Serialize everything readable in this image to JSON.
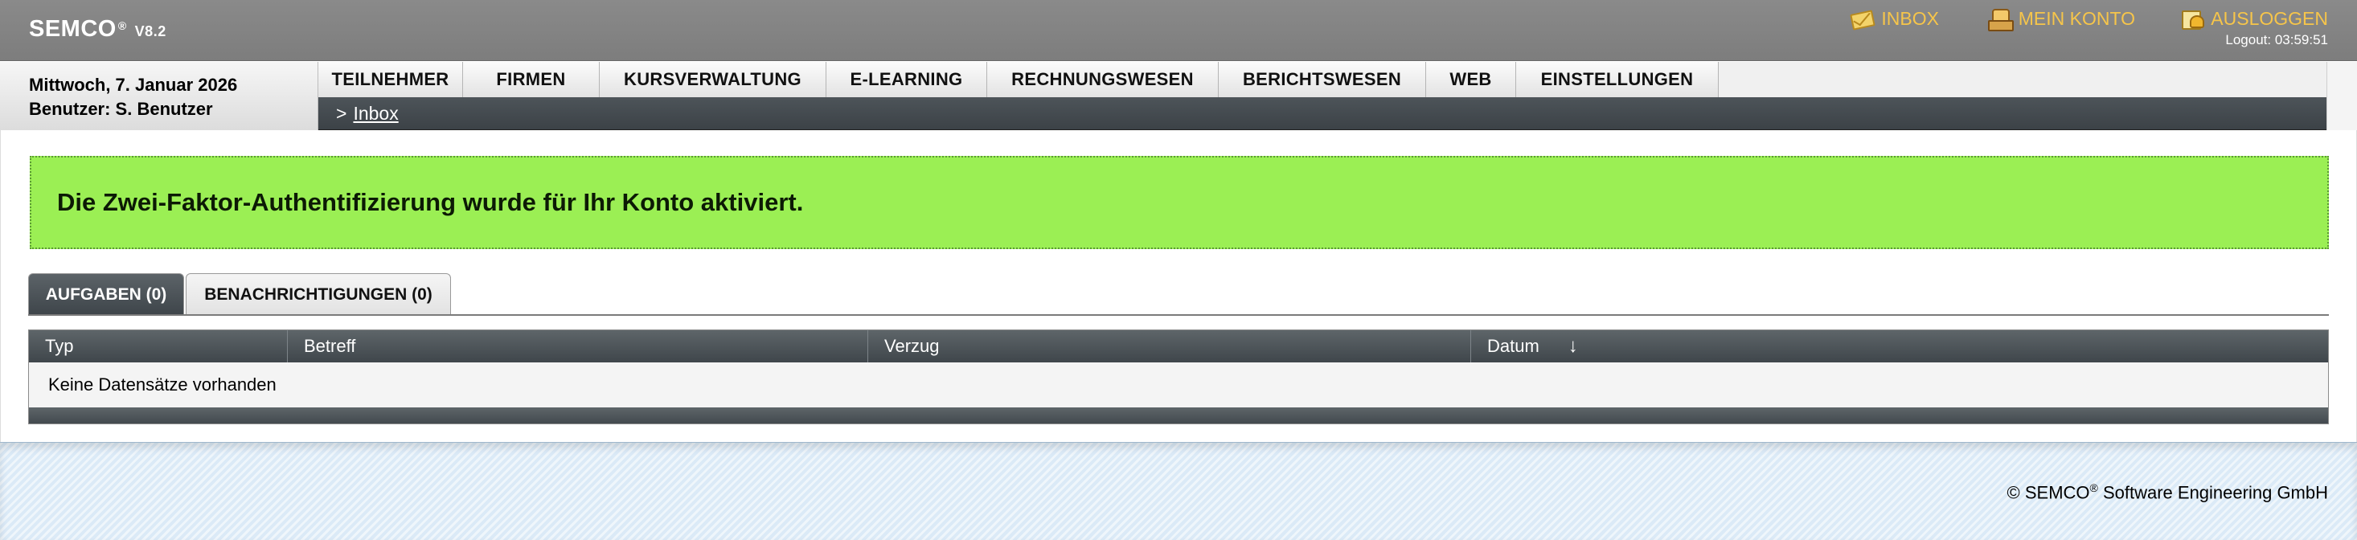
{
  "header": {
    "brand": "SEMCO",
    "brand_reg": "®",
    "version": "V8.2",
    "links": {
      "inbox": "INBOX",
      "account": "MEIN KONTO",
      "logout": "AUSLOGGEN"
    },
    "logout_timer": "Logout: 03:59:51",
    "link_color": "#f6c54a"
  },
  "info": {
    "date": "Mittwoch, 7. Januar 2026",
    "user": "Benutzer: S. Benutzer"
  },
  "nav": {
    "items": [
      "TEILNEHMER",
      "FIRMEN",
      "KURSVERWALTUNG",
      "E-LEARNING",
      "RECHNUNGSWESEN",
      "BERICHTSWESEN",
      "WEB",
      "EINSTELLUNGEN"
    ],
    "breadcrumb_sep": ">",
    "breadcrumb": "Inbox"
  },
  "alert": {
    "message": "Die Zwei-Faktor-Authentifizierung wurde für Ihr Konto aktiviert.",
    "background": "#9bef54"
  },
  "tabs": {
    "tasks": "AUFGABEN (0)",
    "notifications": "BENACHRICHTIGUNGEN (0)"
  },
  "table": {
    "columns": [
      "Typ",
      "Betreff",
      "Verzug",
      "Datum"
    ],
    "sort_indicator": "↓",
    "empty_text": "Keine Datensätze vorhanden"
  },
  "footer": {
    "copyright_prefix": "© SEMCO",
    "copyright_reg": "®",
    "copyright_suffix": " Software Engineering GmbH"
  }
}
